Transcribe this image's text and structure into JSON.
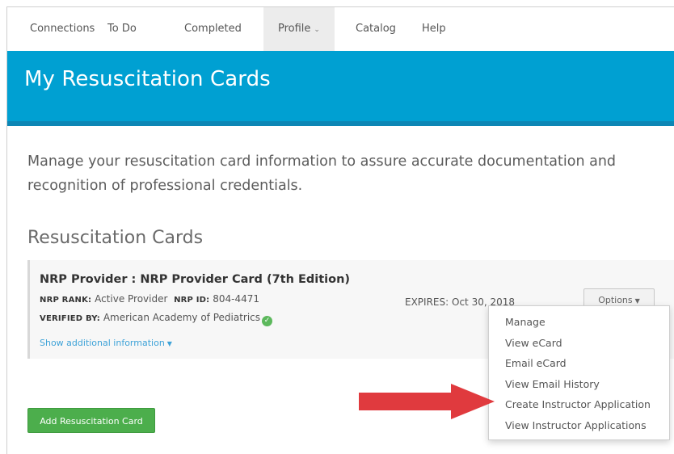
{
  "nav": {
    "items": [
      {
        "label": "Connections"
      },
      {
        "label": "To Do"
      },
      {
        "label": "Completed"
      },
      {
        "label": "Profile",
        "active": true
      },
      {
        "label": "Catalog"
      },
      {
        "label": "Help"
      }
    ]
  },
  "banner": {
    "title": "My Resuscitation Cards",
    "color": "#00a0d2"
  },
  "intro": {
    "line1": "Manage your resuscitation card information to assure accurate documentation and",
    "line2": "recognition of professional credentials."
  },
  "section": {
    "title": "Resuscitation Cards"
  },
  "card": {
    "title": "NRP Provider : NRP Provider Card (7th Edition)",
    "rank_label": "NRP RANK:",
    "rank_value": "Active Provider",
    "id_label": "NRP ID:",
    "id_value": "804-4471",
    "verified_label": "VERIFIED BY:",
    "verified_value": "American Academy of Pediatrics",
    "show_more": "Show additional information",
    "expires_label": "EXPIRES:",
    "expires_value": "Oct 30, 2018",
    "options_label": "Options"
  },
  "dropdown": {
    "items": [
      "Manage",
      "View eCard",
      "Email eCard",
      "View Email History",
      "Create Instructor Application",
      "View Instructor Applications"
    ]
  },
  "add_button": {
    "label": "Add Resuscitation Card",
    "color": "#4cae4c"
  },
  "annotation": {
    "arrow_color": "#e03a3e"
  }
}
